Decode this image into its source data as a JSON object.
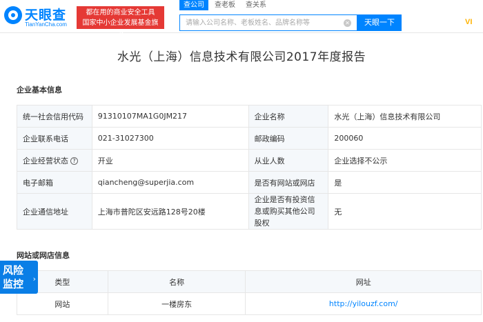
{
  "header": {
    "logo_cn": "天眼查",
    "logo_en": "TianYanCha.com",
    "slogan_line1": "都在用的商业安全工具",
    "slogan_line2": "国家中小企业发展基金旗下",
    "tabs": [
      "查公司",
      "查老板",
      "查关系"
    ],
    "search_placeholder": "请输入公司名称、老板姓名、品牌名称等",
    "search_button": "天眼一下",
    "vip": "VI"
  },
  "report_title": "水光（上海）信息技术有限公司2017年度报告",
  "basic_info": {
    "title": "企业基本信息",
    "rows": [
      {
        "l1": "统一社会信用代码",
        "v1": "91310107MA1G0JM217",
        "l2": "企业名称",
        "v2": "水光（上海）信息技术有限公司"
      },
      {
        "l1": "企业联系电话",
        "v1": "021-31027300",
        "l2": "邮政编码",
        "v2": "200060"
      },
      {
        "l1": "企业经营状态",
        "v1": "开业",
        "l2": "从业人数",
        "v2": "企业选择不公示"
      },
      {
        "l1": "电子邮箱",
        "v1": "qiancheng@superjia.com",
        "l2": "是否有网站或网店",
        "v2": "是"
      },
      {
        "l1": "企业通信地址",
        "v1": "上海市普陀区安远路128号20楼",
        "l2": "企业是否有投资信息或购买其他公司股权",
        "v2": "无"
      }
    ]
  },
  "websites": {
    "title": "网站或网店信息",
    "headers": [
      "类型",
      "名称",
      "网址"
    ],
    "rows": [
      {
        "type": "网站",
        "name": "一楼房东",
        "url": "http://yilouzf.com/"
      }
    ]
  },
  "risk_badge": {
    "line1": "风险",
    "line2": "监控"
  },
  "colors": {
    "brand": "#0084ff",
    "slogan_bg": "#e53935",
    "label_bg": "#f5f8fb"
  }
}
